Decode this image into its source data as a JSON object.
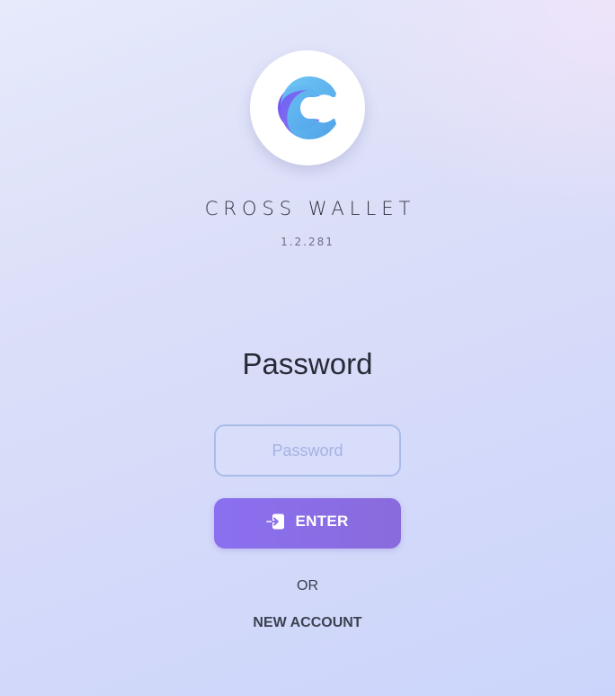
{
  "app": {
    "name": "CROSS WALLET",
    "version": "1.2.281",
    "logo": "cross-wallet-c-logo"
  },
  "login": {
    "title": "Password",
    "password_placeholder": "Password",
    "password_value": "",
    "enter_label": "ENTER",
    "enter_icon": "login-arrow-icon",
    "divider_text": "OR",
    "new_account_label": "NEW ACCOUNT"
  },
  "colors": {
    "accent": "#8a6ff0",
    "input_border": "#a8bce8",
    "placeholder": "#a6b2e2",
    "text_dark": "#262a36"
  }
}
